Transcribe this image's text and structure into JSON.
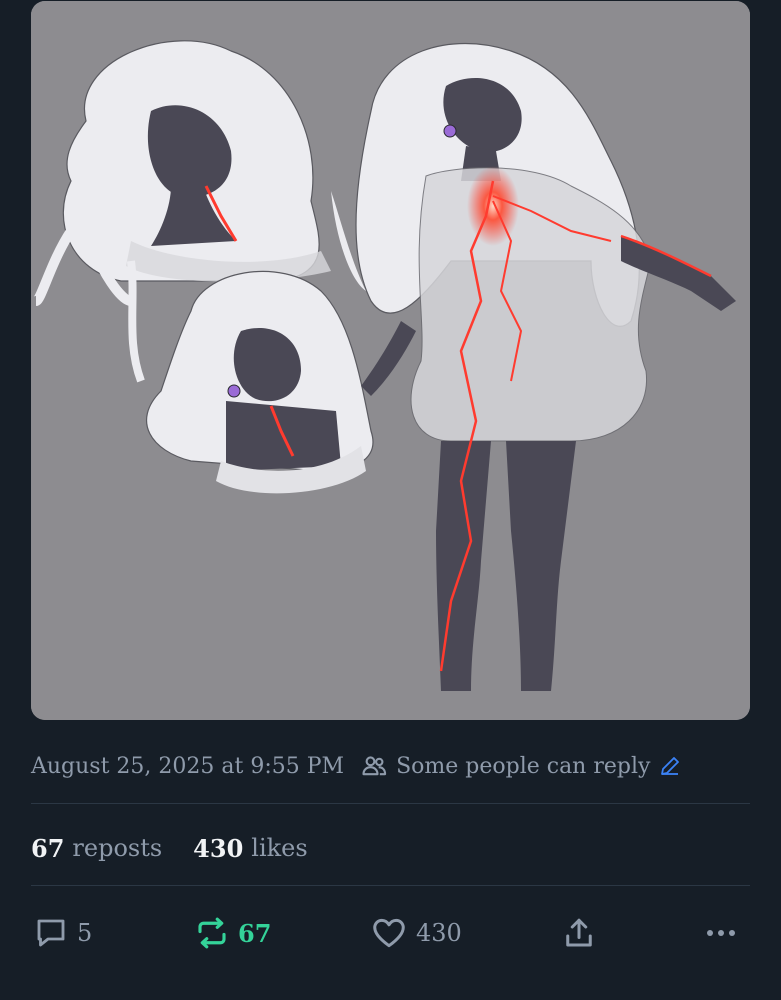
{
  "post": {
    "timestamp": "August 25, 2025 at 9:55 PM",
    "reply_setting": "Some people can reply"
  },
  "counts": {
    "reposts_count": "67",
    "reposts_label": "reposts",
    "likes_count": "430",
    "likes_label": "likes"
  },
  "actions": {
    "reply_count": "5",
    "repost_count": "67",
    "like_count": "430"
  },
  "icons": {
    "audience": "people-icon",
    "edit": "pencil-icon",
    "reply": "speech-bubble-icon",
    "repost": "repost-arrows-icon",
    "like": "heart-icon",
    "share": "share-upload-icon",
    "more": "more-dots-icon"
  },
  "colors": {
    "background": "#161e27",
    "muted_text": "#8f9bab",
    "repost_active": "#34d399",
    "accent_blue": "#3b82f6",
    "glow": "#ff3b2f"
  }
}
